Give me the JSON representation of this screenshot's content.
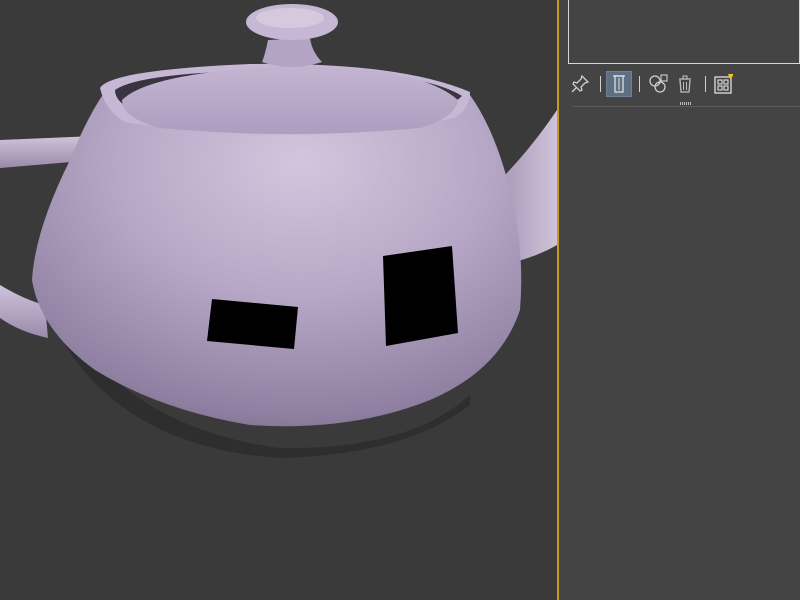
{
  "viewport": {
    "background_color": "#3a3a3a",
    "object": "teapot",
    "object_color": "#b9a9c9",
    "border_color": "#c79a1a"
  },
  "command_panel": {
    "background_color": "#444444",
    "modifier_list": {
      "items": []
    },
    "stack_toolbar": {
      "buttons": [
        {
          "name": "pin-stack-icon",
          "active": false
        },
        {
          "name": "show-end-result-icon",
          "active": true
        },
        {
          "name": "make-unique-icon",
          "active": false
        },
        {
          "name": "remove-modifier-icon",
          "active": false
        },
        {
          "name": "configure-modifier-sets-icon",
          "active": false
        }
      ],
      "active_color": "#5d6f82"
    }
  }
}
